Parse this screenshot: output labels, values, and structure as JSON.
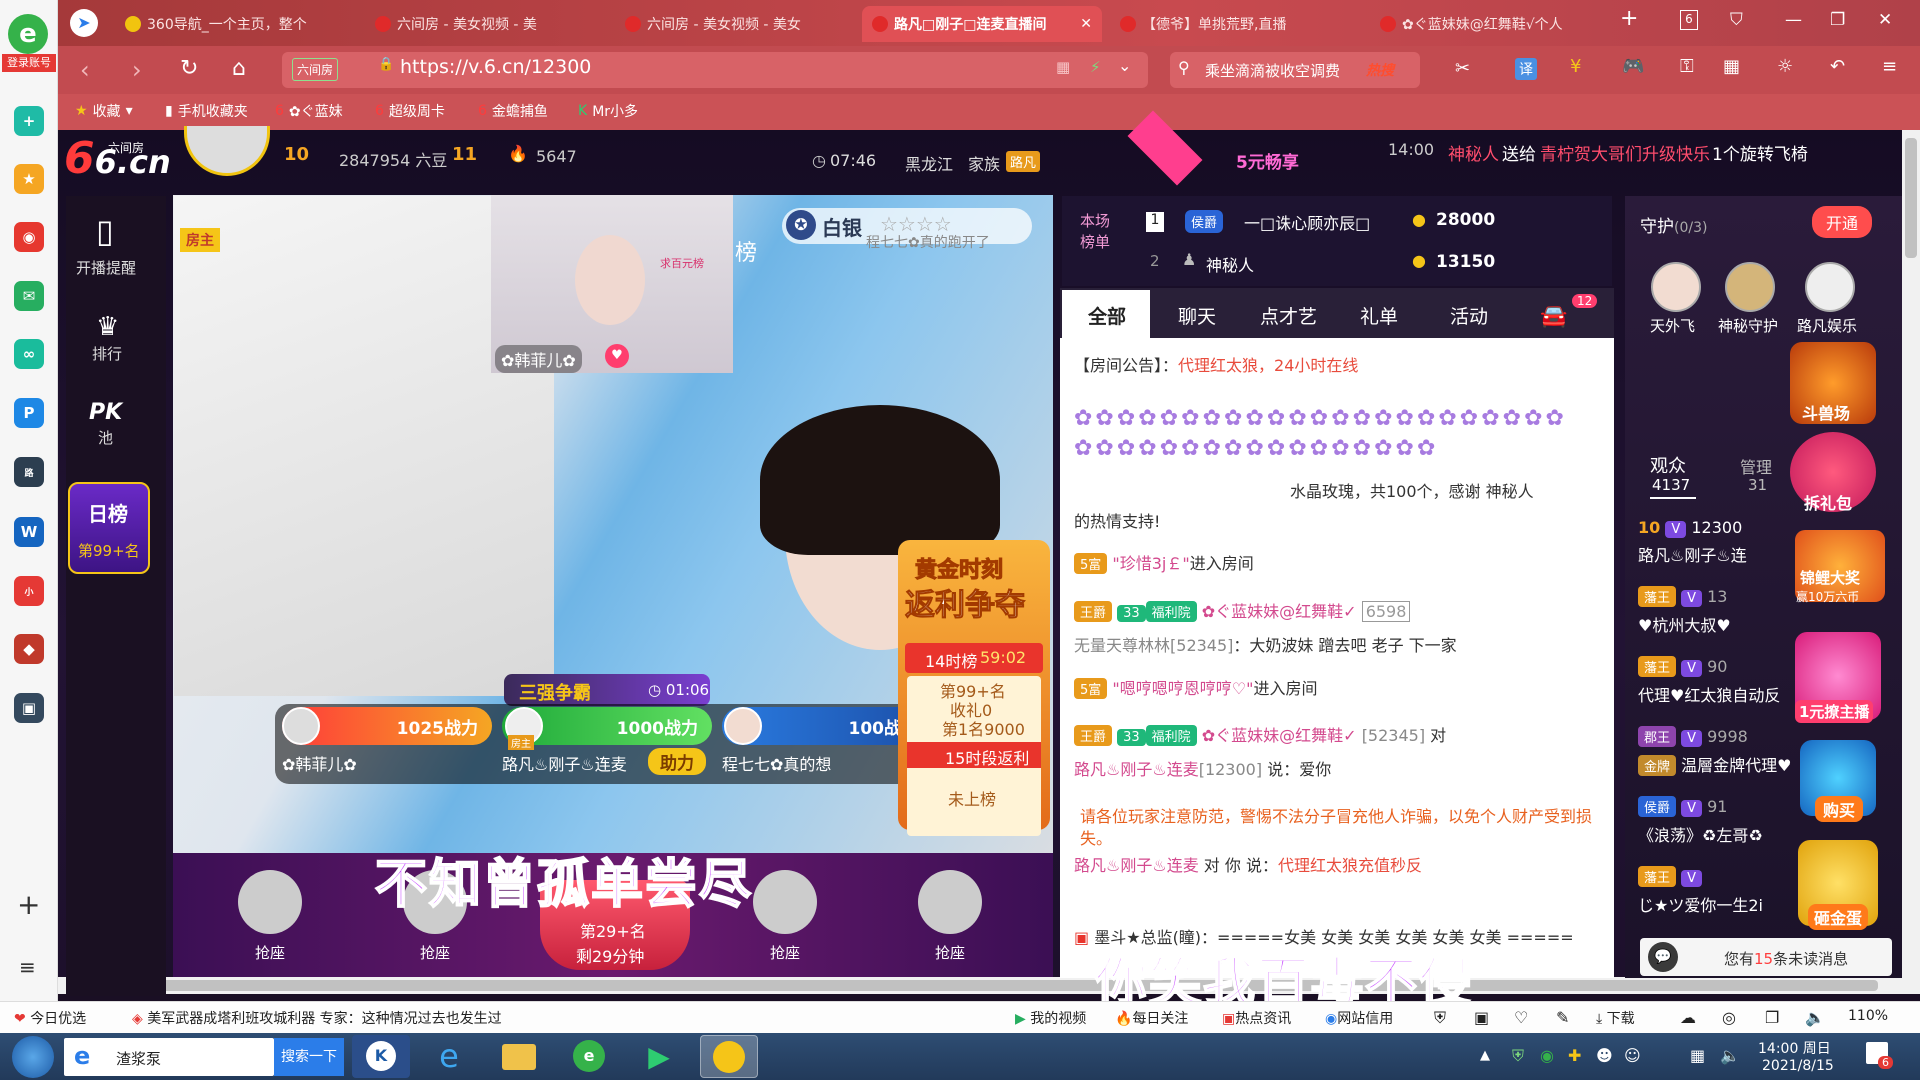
{
  "rail": {
    "login_label": "登录账号"
  },
  "tabs": [
    {
      "label": "360导航_一个主页，整个"
    },
    {
      "label": "六间房 - 美女视频 - 美"
    },
    {
      "label": "六间房 - 美女视频 - 美女"
    },
    {
      "label": "路凡□刚子□连麦直播间"
    },
    {
      "label": "【德爷】单挑荒野,直播"
    },
    {
      "label": "✿ぐ蓝妹妹@红舞鞋√个人"
    }
  ],
  "window": {
    "tab_count": "6"
  },
  "address": {
    "site_tag": "六间房",
    "url": "https://v.6.cn/12300",
    "search_text": "乘坐滴滴被收空调费",
    "search_hot": "热搜",
    "translate": "译"
  },
  "bookmarks": [
    {
      "label": "收藏"
    },
    {
      "label": "手机收藏夹"
    },
    {
      "label": "✿ぐ蓝妹"
    },
    {
      "label": "超级周卡"
    },
    {
      "label": "金蟾捕鱼"
    },
    {
      "label": "Mr小多"
    }
  ],
  "header": {
    "logo": "6.cn",
    "logo_sub": "六间房",
    "level": "10",
    "beans": "2847954 六豆",
    "wealth": "11",
    "fire": "5647",
    "time": "07:46",
    "region": "黑龙江",
    "family": "家族",
    "family_tag": "路凡",
    "promo": "5元畅享",
    "ticker_time": "14:00",
    "ticker_user": "神秘人",
    "ticker_text": "送给",
    "ticker_target": "青柠贺大哥们升级快乐",
    "ticker_gift": "1个旋转飞椅"
  },
  "sidebar": {
    "live_remind": "开播提醒",
    "rank": "排行",
    "pk": "PK",
    "pk_sub": "池",
    "daily": "日榜",
    "daily_rank": "第99+名"
  },
  "stream": {
    "host_tag": "房主",
    "guest_name": "✿韩菲儿✿",
    "silver": "白银",
    "guest_badge": "求百元榜",
    "cut_text": "程七七✿真的跑开了",
    "board": "榜",
    "pk_title": "三强争霸",
    "pk_timer": "01:06",
    "pk1_power": "1025战力",
    "pk1_name": "✿韩菲儿✿",
    "pk2_power": "1000战力",
    "pk2_name": "路凡♨刚子♨连麦",
    "pk2_host": "房主",
    "pk_help": "助力",
    "pk3_power": "100战力",
    "pk3_name": "程七七✿真的想",
    "event_title": "黄金时刻",
    "event_sub": "返利争夺",
    "event_hour": "14时榜",
    "event_timer": "59:02",
    "event_rank": "第99+名",
    "event_gift": "收礼0",
    "event_first": "第1名9000",
    "event_rebate": "15时段返利",
    "event_status": "未上榜",
    "seat_label": "抢座",
    "center_rank": "第29+名",
    "center_remain": "剩29分钟",
    "lyric1": "不知曾孤单尝尽",
    "lyric2": "你笑我百毒不侵"
  },
  "rank_board": {
    "title": "本场榜单",
    "row1_rank": "1",
    "row1_badge": "侯爵",
    "row1_name": "一□诛心顾亦辰□",
    "row1_score": "28000",
    "row2_rank": "2",
    "row2_name": "神秘人",
    "row2_score": "13150"
  },
  "chat": {
    "tabs": [
      "全部",
      "聊天",
      "点才艺",
      "礼单",
      "活动"
    ],
    "car_count": "12",
    "notice_label": "【房间公告】：",
    "notice_text": "代理红太狼，24小时在线",
    "gift_msg": "水晶玫瑰，共100个，感谢",
    "gift_user": "神秘人",
    "gift_end": "的热情支持!",
    "m1_badge": "5富",
    "m1_name": "\"珍惜3j￡\"",
    "m1_text": "进入房间",
    "m2_badge": "王爵",
    "m2_level": "33",
    "m2_tag": "福利院",
    "m2_name": "✿ぐ蓝妹妹@红舞鞋✓",
    "m2_num": "6598",
    "m2_from": "无量天尊林林",
    "m2_id": "[52345]",
    "m2_text": "：大奶波妹 蹭去吧 老子 下一家",
    "m3_badge": "5富",
    "m3_name": "\"嗯哼嗯哼恩哼哼♡\"",
    "m3_text": "进入房间",
    "m4_badge": "王爵",
    "m4_level": "33",
    "m4_tag": "福利院",
    "m4_name": "✿ぐ蓝妹妹@红舞鞋✓",
    "m4_id": "[52345]",
    "m4_to": "对",
    "m4_target": "路凡♨刚子♨连麦",
    "m4_tid": "[12300]",
    "m4_say": "说：爱你",
    "warn": "请各位玩家注意防范，警惕不法分子冒充他人诈骗，以免个人财产受到损失。",
    "m5_from": "路凡♨刚子♨连麦",
    "m5_mid": "对 你 说：",
    "m5_text": "代理红太狼充值秒反",
    "m6": "墨斗★总监(瞳)：=====女美 女美 女美 女美 女美 女美 ====="
  },
  "right": {
    "guard_title": "守护",
    "guard_count": "(0/3)",
    "open_btn": "开通",
    "guards": [
      {
        "name": "天外飞"
      },
      {
        "name": "神秘守护"
      },
      {
        "name": "路凡娱乐"
      }
    ],
    "arena": "斗兽场",
    "aud_label": "观众",
    "aud_count": "4137",
    "mgr_label": "管理",
    "mgr_count": "31",
    "gift_pack": "拆礼包",
    "room_level": "10",
    "room_id": "12300",
    "u1": "路凡♨刚子♨连",
    "lucky": "锦鲤大奖",
    "lucky_sub": "赢10万六币",
    "u2_badge": "藩王",
    "u2": "♥杭州大叔♥",
    "u2_num": "13",
    "u3_badge": "藩王",
    "u3": "代理♥红太狼自动反",
    "u3_num": "90",
    "u4_badge": "郡王",
    "u4": "温層金牌代理♥",
    "u4_num": "9998",
    "u4_sub": "金牌",
    "u5_badge": "侯爵",
    "u5": "《浪荡》♻左哥♻",
    "u5_num": "91",
    "u6_badge": "藩王",
    "u6": "じ★ツ爱你一生2i",
    "promo1": "1元撩主播",
    "promo2": "购买",
    "promo3": "砸金蛋",
    "unread_pre": "您有",
    "unread_num": "15",
    "unread_post": "条未读消息"
  },
  "statusbar": {
    "pick": "今日优选",
    "news": "美军武器成塔利班攻城利器 专家：这种情况过去也发生过",
    "video": "我的视频",
    "follow": "每日关注",
    "hot": "热点资讯",
    "bank": "网站信用",
    "download": "下载",
    "zoom": "110%"
  },
  "taskbar": {
    "search_value": "渣浆泵",
    "search_btn": "搜索一下",
    "clock": "14:00 周日",
    "date": "2021/8/15",
    "notif": "6"
  }
}
